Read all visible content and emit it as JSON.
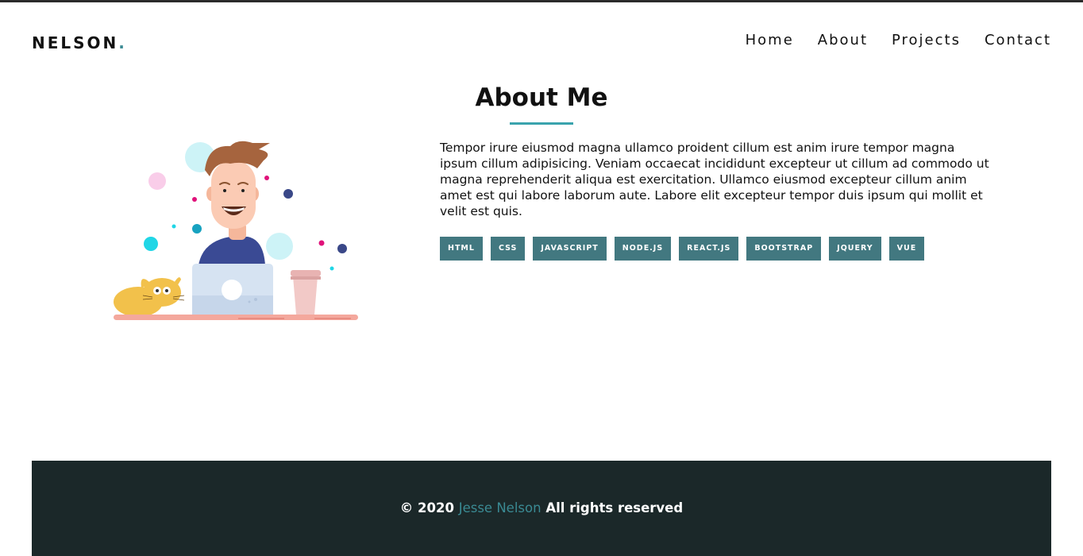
{
  "header": {
    "brand": "NELSON",
    "brand_dot": ".",
    "nav": [
      {
        "label": "Home"
      },
      {
        "label": "About"
      },
      {
        "label": "Projects"
      },
      {
        "label": "Contact"
      }
    ]
  },
  "about": {
    "title": "About Me",
    "description": "Tempor irure eiusmod magna ullamco proident cillum est anim irure tempor magna ipsum cillum adipisicing. Veniam occaecat incididunt excepteur ut cillum ad commodo ut magna reprehenderit aliqua est exercitation. Ullamco eiusmod excepteur cillum anim amet est qui labore laborum aute. Labore elit excepteur tempor duis ipsum qui mollit et velit est quis.",
    "skills": [
      "HTML",
      "CSS",
      "JAVASCRIPT",
      "NODE.JS",
      "REACT.JS",
      "BOOTSTRAP",
      "JQUERY",
      "VUE"
    ]
  },
  "footer": {
    "copyright": "© 2020",
    "author": "Jesse Nelson",
    "rights": "All rights reserved"
  },
  "colors": {
    "accent": "#3a8a93",
    "skill_badge": "#427880",
    "footer_bg": "#1b2829"
  }
}
